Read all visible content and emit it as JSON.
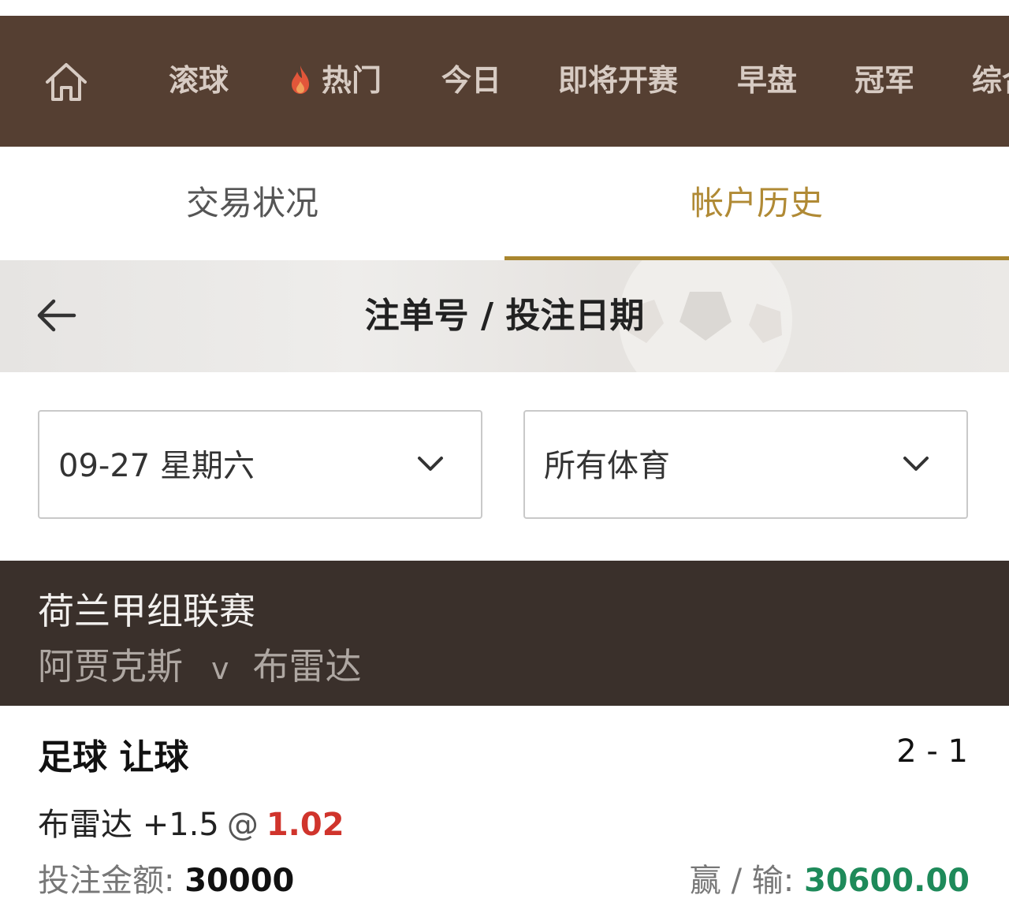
{
  "nav": {
    "home_icon": "home-icon",
    "items": [
      {
        "label": "滚球"
      },
      {
        "label": "热门",
        "icon": "flame-icon"
      },
      {
        "label": "今日"
      },
      {
        "label": "即将开赛"
      },
      {
        "label": "早盘"
      },
      {
        "label": "冠军"
      },
      {
        "label": "综合"
      }
    ]
  },
  "tabs": {
    "trading": "交易状况",
    "history": "帐户历史",
    "active": "history"
  },
  "subheader": {
    "back_icon": "back-arrow-icon",
    "title": "注单号 / 投注日期"
  },
  "filters": {
    "date": "09-27 星期六",
    "sport": "所有体育",
    "chevron_icon": "chevron-down-icon"
  },
  "bet": {
    "league": "荷兰甲组联赛",
    "home_team": "阿贾克斯",
    "vs": "v",
    "away_team": "布雷达",
    "bet_type": "足球 让球",
    "score": "2 - 1",
    "selection": "布雷达 +1.5",
    "at": "@",
    "odds": "1.02",
    "stake_label": "投注金额: ",
    "stake": "30000",
    "winloss_label": "赢 / 输: ",
    "winloss": "30600.00"
  },
  "colors": {
    "nav_bg": "#553f32",
    "accent_gold": "#a9862f",
    "league_bg": "#3a302b",
    "odds_red": "#d0342c",
    "win_green": "#1e8a5a",
    "flame": "#e2563a"
  }
}
